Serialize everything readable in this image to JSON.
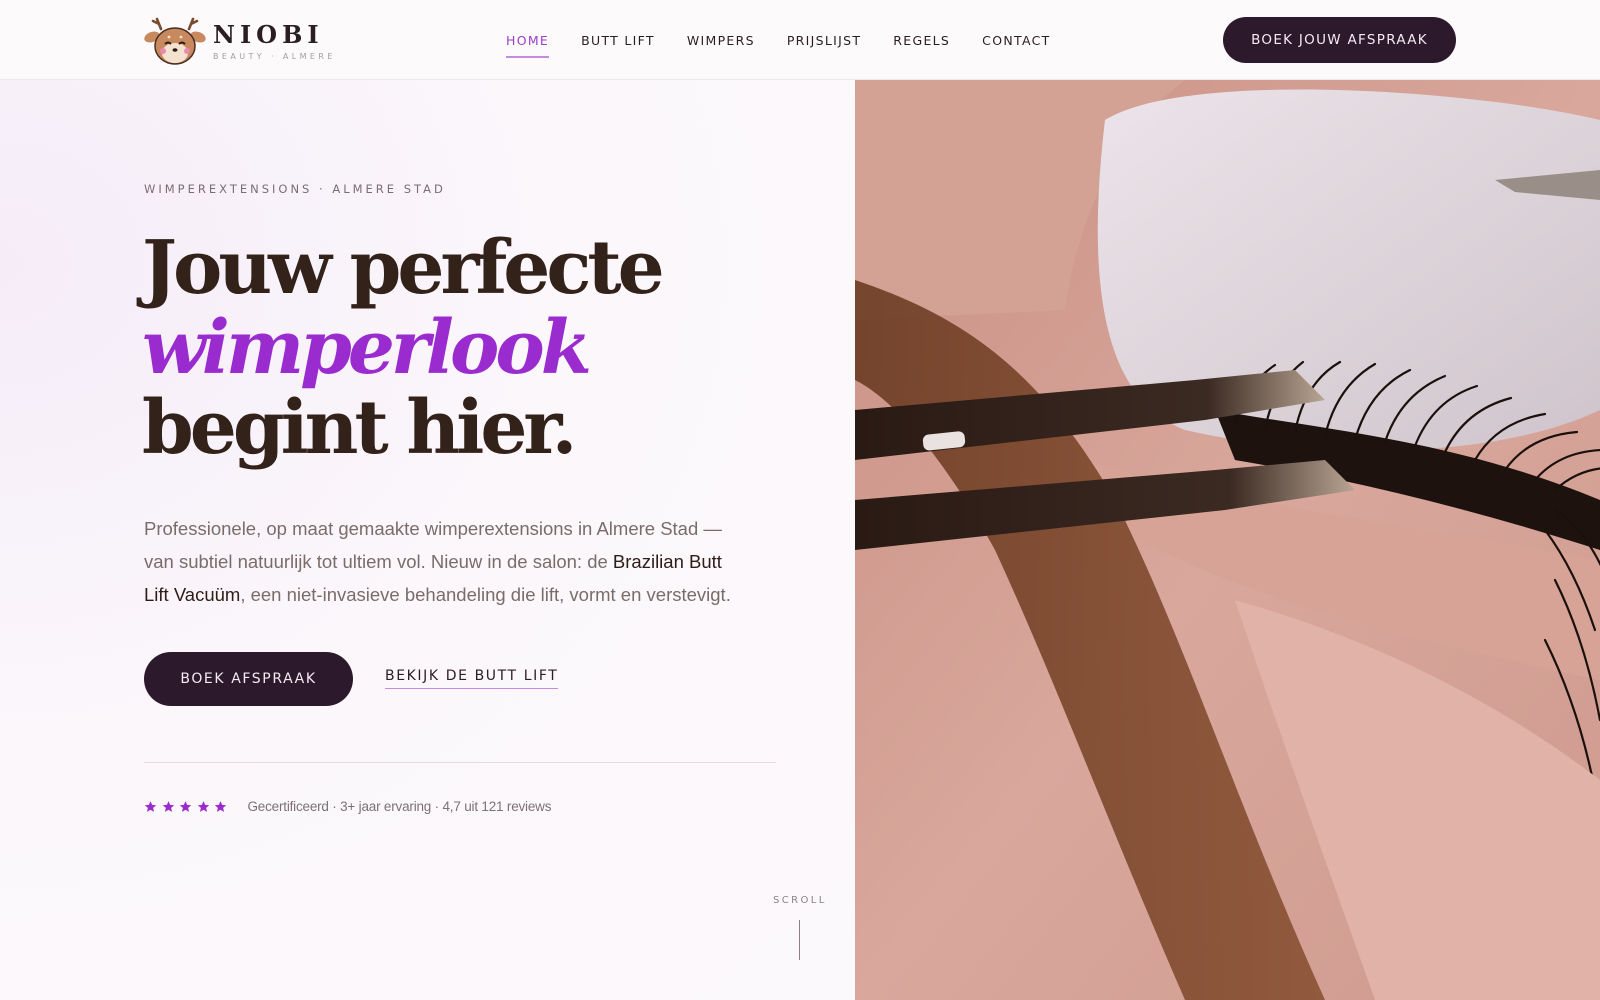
{
  "brand": {
    "name": "NIOBI",
    "tagline": "BEAUTY · ALMERE",
    "logo_icon": "deer-face-icon"
  },
  "nav": {
    "items": [
      {
        "label": "HOME",
        "active": true
      },
      {
        "label": "BUTT LIFT",
        "active": false
      },
      {
        "label": "WIMPERS",
        "active": false
      },
      {
        "label": "PRIJSLIJST",
        "active": false
      },
      {
        "label": "REGELS",
        "active": false
      },
      {
        "label": "CONTACT",
        "active": false
      }
    ],
    "cta_label": "BOEK JOUW AFSPRAAK"
  },
  "hero": {
    "eyebrow": "WIMPEREXTENSIONS · ALMERE STAD",
    "headline_line1": "Jouw perfecte",
    "headline_accent": "wimperlook",
    "headline_line3": "begint hier.",
    "intro_part1": "Professionele, op maat gemaakte wimperextensions in Almere Stad — van subtiel natuurlijk tot ultiem vol. Nieuw in de salon: de ",
    "intro_highlight": "Brazilian Butt Lift Vacuüm",
    "intro_part2": ", een niet-invasieve behandeling die lift, vormt en verstevigt.",
    "primary_button": "BOEK AFSPRAAK",
    "secondary_link": "BEKIJK DE BUTT LIFT",
    "rating_stars": 5,
    "rating_text": "Gecertificeerd · 3+ jaar ervaring · 4,7 uit 121 reviews",
    "scroll_label": "SCROLL"
  },
  "colors": {
    "accent_purple": "#9a2bcf",
    "dark_button": "#2c1a2c",
    "headline_brown": "#33221a",
    "underline_lilac": "#c88ae0"
  },
  "image": {
    "subject": "lash-extension-closeup-photo"
  }
}
